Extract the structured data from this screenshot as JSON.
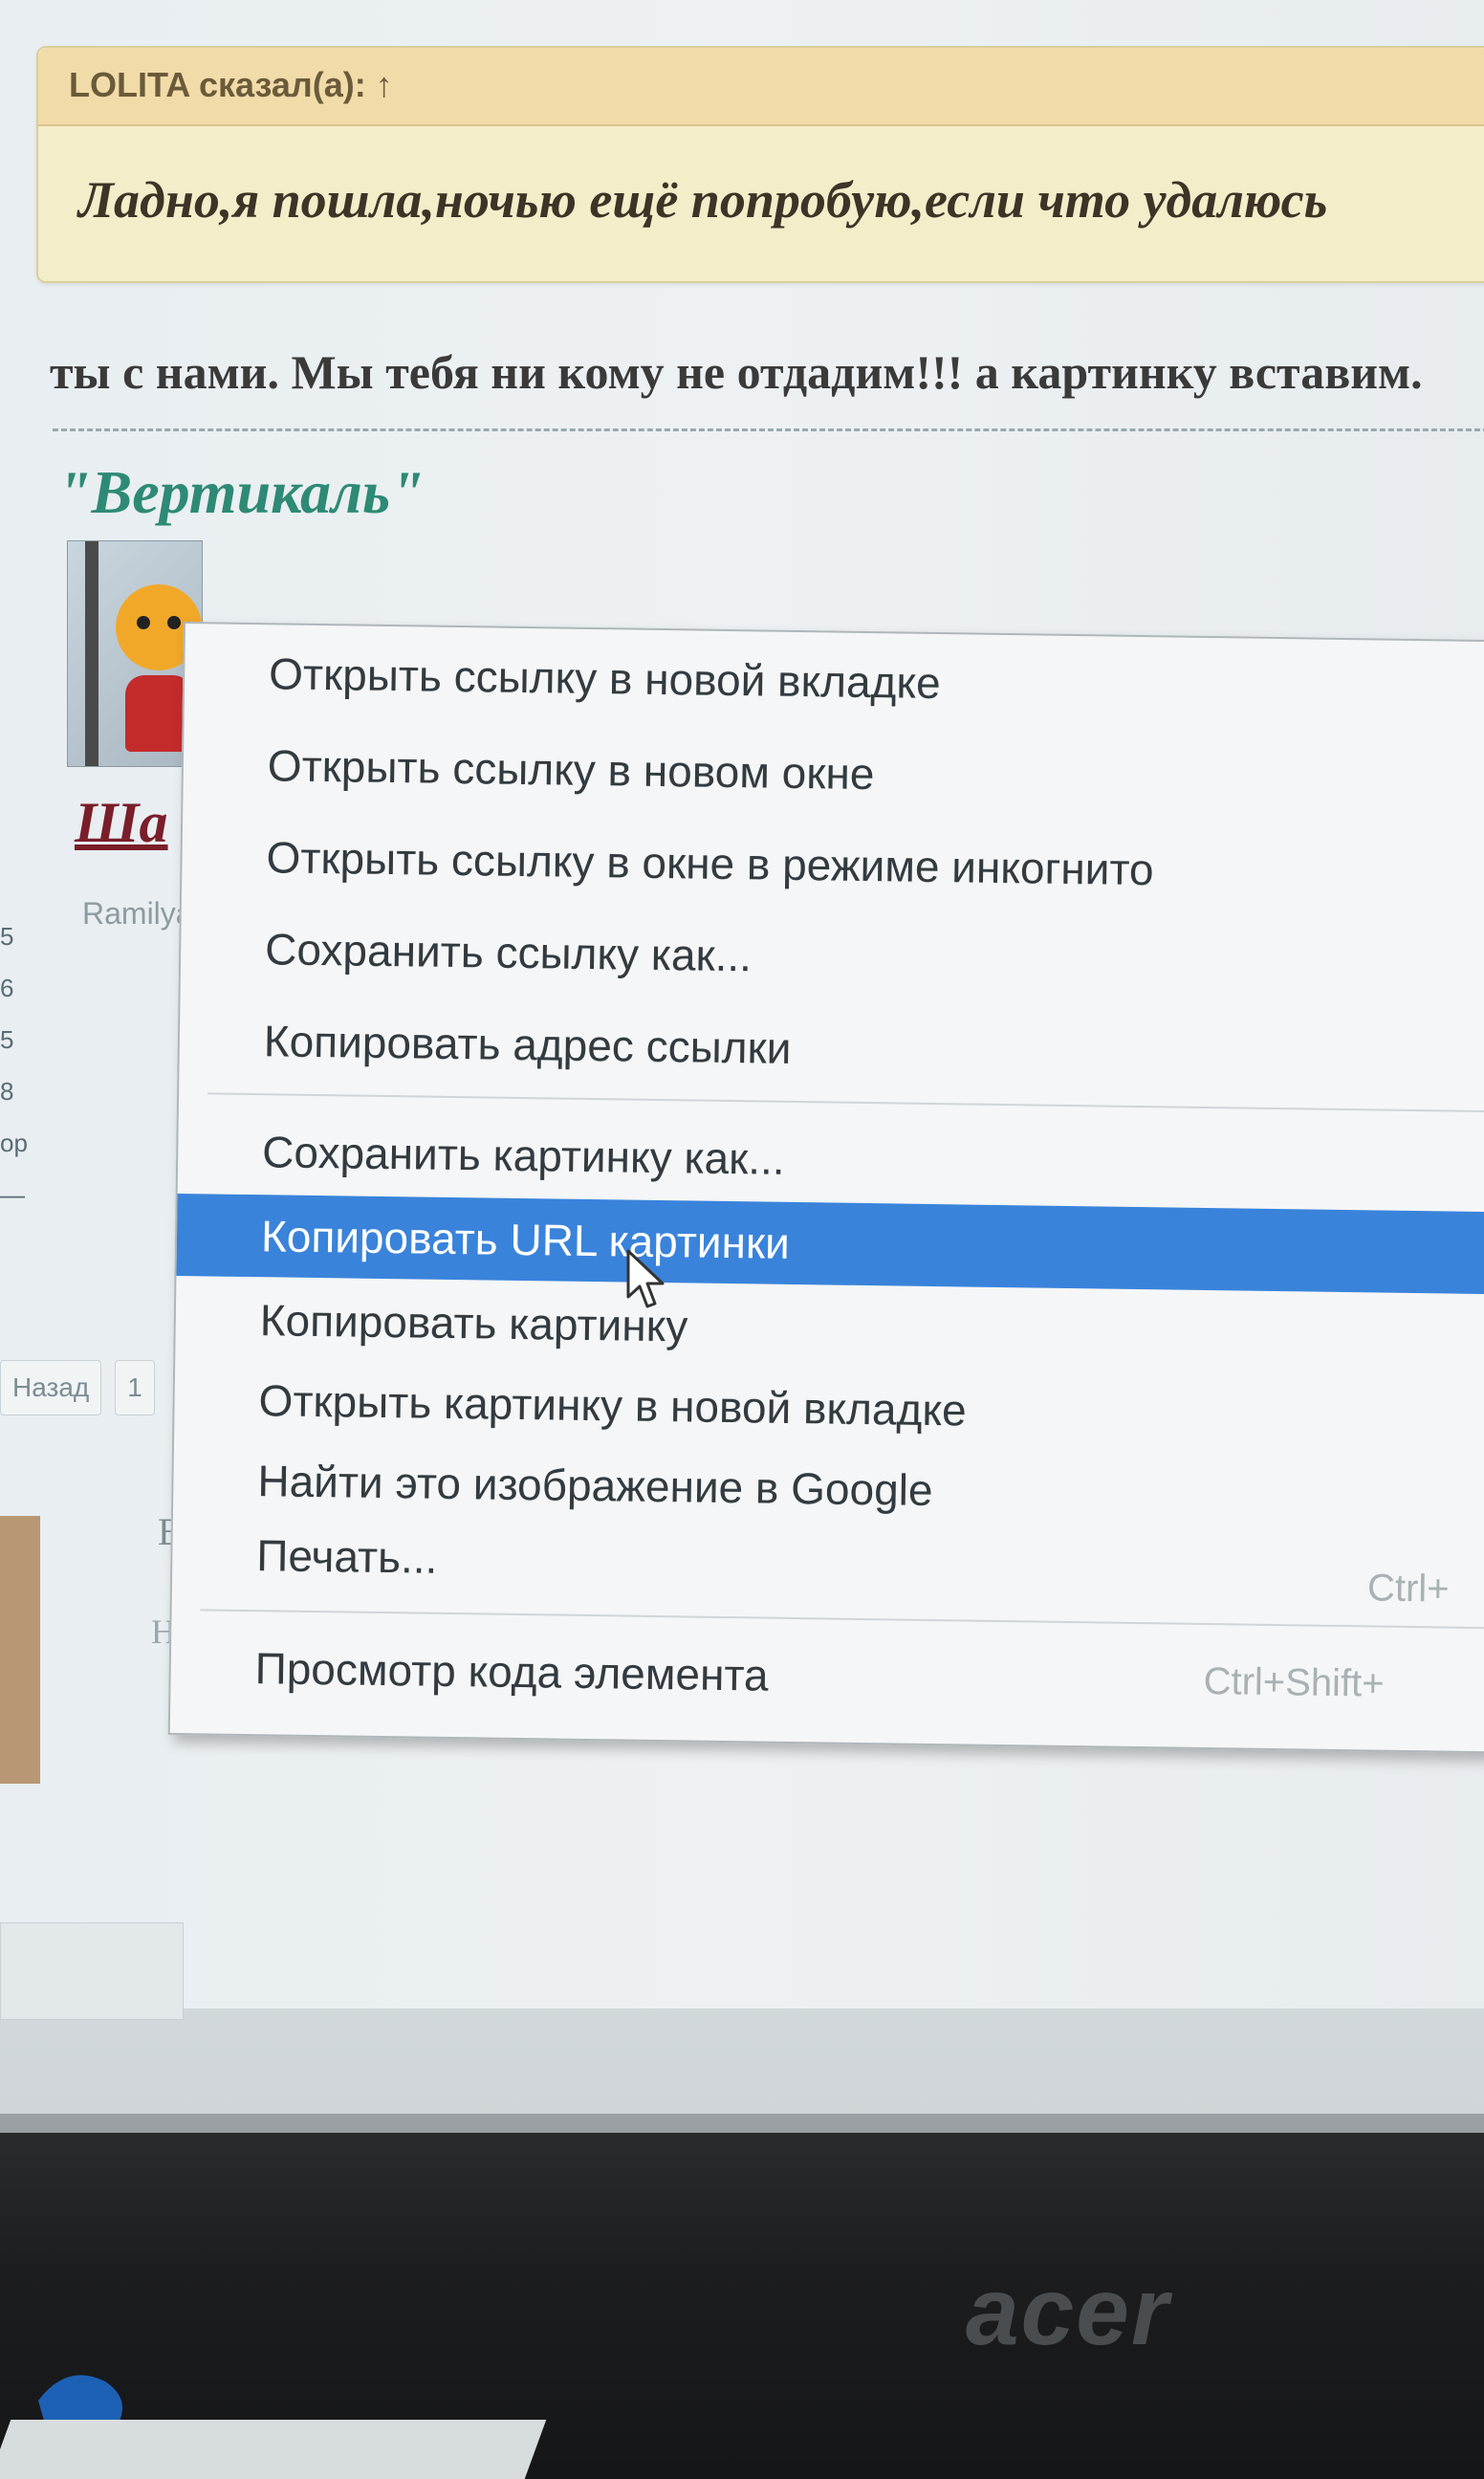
{
  "quote": {
    "author": "LOLITA сказал(а): ↑",
    "text": "Ладно,я пошла,ночью ещё попробую,если что удалюсь"
  },
  "post": {
    "reply_text": "ты с нами. Мы тебя ни кому не отдадим!!! а картинку вставим.",
    "signature_title": "\"Вертикаль\"",
    "signature_fragment": "Ша",
    "username": "Ramilya"
  },
  "side_numbers": [
    "5",
    "6",
    "5",
    "8",
    "ор",
    "—"
  ],
  "pager": {
    "back_label": "Назад",
    "page_label": "1"
  },
  "left_fragments": {
    "letter": "В",
    "frag": "Нап"
  },
  "context_menu": {
    "group1": [
      {
        "label": "Открыть ссылку в новой вкладке"
      },
      {
        "label": "Открыть ссылку в новом окне"
      },
      {
        "label": "Открыть ссылку в окне в режиме инкогнито"
      },
      {
        "label": "Сохранить ссылку как..."
      },
      {
        "label": "Копировать адрес ссылки"
      }
    ],
    "group2": [
      {
        "label": "Сохранить картинку как..."
      },
      {
        "label": "Копировать URL картинки",
        "active": true
      },
      {
        "label": "Копировать картинку"
      },
      {
        "label": "Открыть картинку в новой вкладке"
      },
      {
        "label": "Найти это изображение в Google"
      },
      {
        "label": "Печать...",
        "shortcut": "Ctrl+"
      }
    ],
    "group3": [
      {
        "label": "Просмотр кода элемента",
        "shortcut": "Ctrl+Shift+"
      }
    ],
    "highlight_color": "#3a83db"
  },
  "monitor": {
    "brand": "acer"
  }
}
